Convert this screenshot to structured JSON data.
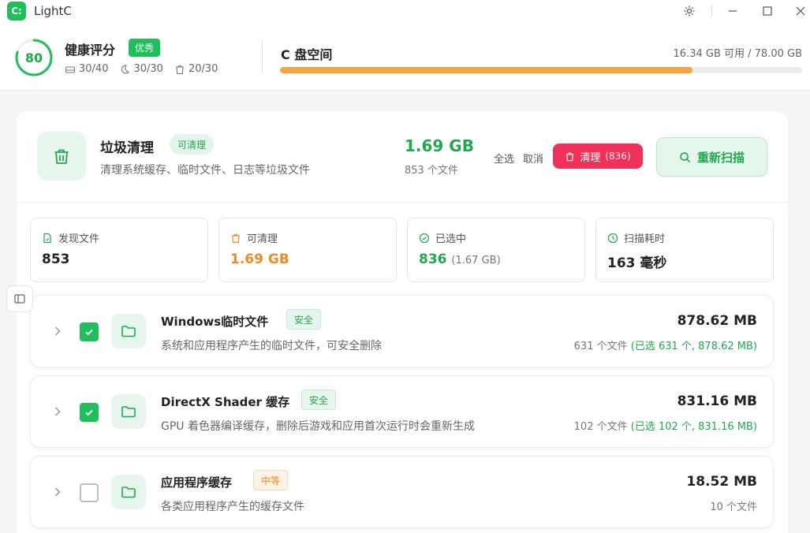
{
  "window": {
    "logo_text": "C:",
    "title": "LightC"
  },
  "health": {
    "score": "80",
    "score_fraction": 0.8,
    "title": "健康评分",
    "badge": "优秀",
    "metrics": [
      {
        "icon": "disk-icon",
        "value": "30/40"
      },
      {
        "icon": "moon-icon",
        "value": "30/30"
      },
      {
        "icon": "trash-icon",
        "value": "20/30"
      }
    ]
  },
  "disk": {
    "title": "C 盘空间",
    "info": "16.34 GB 可用 / 78.00 GB",
    "used_fraction": 0.79
  },
  "junk": {
    "title": "垃圾清理",
    "badge": "可清理",
    "description": "清理系统缓存、临时文件、日志等垃圾文件",
    "size": "1.69 GB",
    "count": "853 个文件",
    "select_all": "全选",
    "cancel": "取消",
    "clean_label": "清理",
    "clean_count": "(836)",
    "rescan_label": "重新扫描"
  },
  "stats": [
    {
      "icon": "file-icon",
      "label": "发现文件",
      "value": "853",
      "sub": ""
    },
    {
      "icon": "trash-icon",
      "label": "可清理",
      "value": "1.69 GB",
      "sub": ""
    },
    {
      "icon": "check-circle-icon",
      "label": "已选中",
      "value": "836",
      "sub": "(1.67 GB)"
    },
    {
      "icon": "clock-icon",
      "label": "扫描耗时",
      "value": "163 毫秒",
      "sub": ""
    }
  ],
  "categories": [
    {
      "name": "Windows临时文件",
      "tag": "安全",
      "description": "系统和应用程序产生的临时文件，可安全删除",
      "size": "878.62 MB",
      "count": "631 个文件",
      "selected": "(已选 631 个, 878.62 MB)",
      "checked": true
    },
    {
      "name": "DirectX Shader 缓存",
      "tag": "安全",
      "description": "GPU 着色器编译缓存，删除后游戏和应用首次运行时会重新生成",
      "size": "831.16 MB",
      "count": "102 个文件",
      "selected": "(已选 102 个, 831.16 MB)",
      "checked": true
    },
    {
      "name": "应用程序缓存",
      "tag": "中等",
      "description": "各类应用程序产生的缓存文件",
      "size": "18.52 MB",
      "count": "10 个文件",
      "selected": "",
      "checked": false
    }
  ],
  "colors": {
    "brand_green": "#1fbf5b",
    "accent_green": "#1fa84f",
    "orange": "#f08a24",
    "danger": "#f0325a",
    "disk_bar": "#f5a542"
  }
}
